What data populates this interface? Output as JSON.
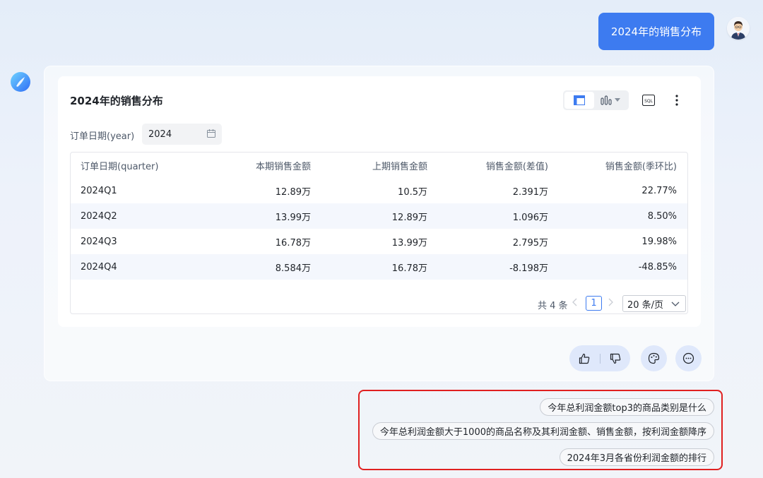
{
  "user_message": "2024年的销售分布",
  "result": {
    "title": "2024年的销售分布",
    "filter_label": "订单日期(year)",
    "filter_value": "2024",
    "columns": [
      "订单日期(quarter)",
      "本期销售金额",
      "上期销售金额",
      "销售金额(差值)",
      "销售金额(季环比)"
    ],
    "rows": [
      [
        "2024Q1",
        "12.89万",
        "10.5万",
        "2.391万",
        "22.77%"
      ],
      [
        "2024Q2",
        "13.99万",
        "12.89万",
        "1.096万",
        "8.50%"
      ],
      [
        "2024Q3",
        "16.78万",
        "13.99万",
        "2.795万",
        "19.98%"
      ],
      [
        "2024Q4",
        "8.584万",
        "16.78万",
        "-8.198万",
        "-48.85%"
      ]
    ],
    "pagination": {
      "total": "共 4 条",
      "current_page": "1",
      "page_size": "20 条/页"
    },
    "sql_label": "SQL"
  },
  "suggestions": [
    "今年总利润金额top3的商品类别是什么",
    "今年总利润金额大于1000的商品名称及其利润金额、销售金额，按利润金额降序",
    "2024年3月各省份利润金额的排行"
  ],
  "colors": {
    "accent": "#3d7bf0",
    "highlight_border": "#e02020"
  },
  "icons": [
    "table-view-icon",
    "bar-chart-icon",
    "sql-icon",
    "more-icon",
    "calendar-icon",
    "thumbs-up-icon",
    "thumbs-down-icon",
    "palette-icon",
    "more-horizontal-icon"
  ]
}
